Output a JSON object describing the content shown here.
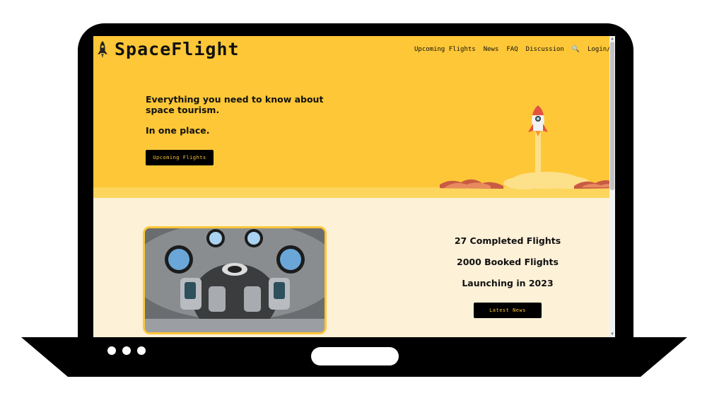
{
  "header": {
    "logo_text": "SpaceFlight",
    "logo_icon": "rocket-icon",
    "nav": [
      {
        "label": "Upcoming Flights"
      },
      {
        "label": "News"
      },
      {
        "label": "FAQ"
      },
      {
        "label": "Discussion"
      },
      {
        "label": "Login/Sign-up"
      }
    ],
    "search_icon": "search-icon",
    "search_glyph": "🔍"
  },
  "hero": {
    "headline_line1": "Everything you need to know about",
    "headline_line2": "space tourism.",
    "subheadline": "In one place.",
    "cta_label": "Upcoming Flights"
  },
  "stats": {
    "items": [
      {
        "text": "27 Completed Flights"
      },
      {
        "text": "2000 Booked Flights"
      },
      {
        "text": "Launching in 2023"
      }
    ],
    "cta_label": "Latest News"
  },
  "colors": {
    "accent": "#fdc737",
    "background_light": "#fdf1d8",
    "button": "#000000"
  }
}
